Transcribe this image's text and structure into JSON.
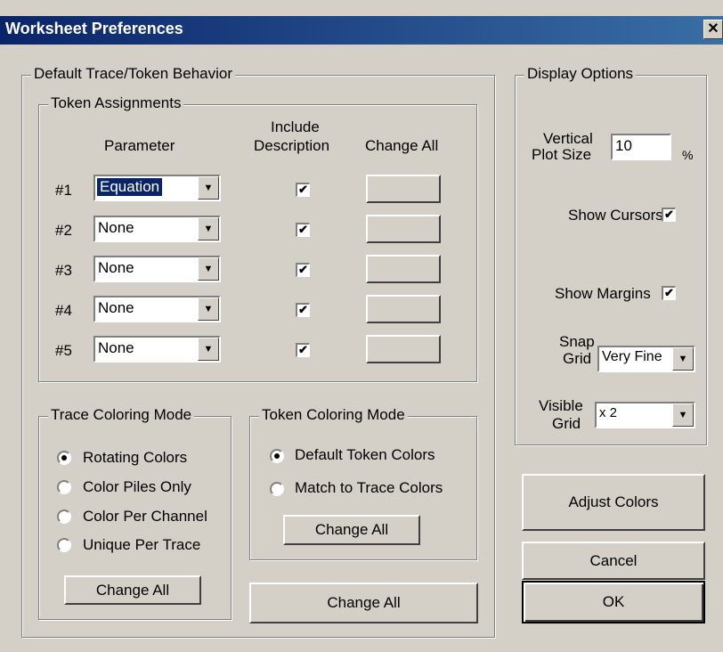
{
  "window": {
    "title": "Worksheet Preferences",
    "close_glyph": "✕"
  },
  "default_trace": {
    "legend": "Default Trace/Token Behavior",
    "token_assignments": {
      "legend": "Token Assignments",
      "headers": {
        "parameter": "Parameter",
        "include_description_1": "Include",
        "include_description_2": "Description",
        "change_all": "Change All"
      },
      "rows": [
        {
          "label": "#1",
          "parameter": "Equation",
          "include": true,
          "selected": true
        },
        {
          "label": "#2",
          "parameter": "None",
          "include": true
        },
        {
          "label": "#3",
          "parameter": "None",
          "include": true
        },
        {
          "label": "#4",
          "parameter": "None",
          "include": true
        },
        {
          "label": "#5",
          "parameter": "None",
          "include": true
        }
      ]
    },
    "trace_coloring": {
      "legend": "Trace Coloring Mode",
      "options": [
        "Rotating Colors",
        "Color Piles Only",
        "Color Per Channel",
        "Unique Per Trace"
      ],
      "selected": "Rotating Colors",
      "button": "Change All"
    },
    "token_coloring": {
      "legend": "Token Coloring Mode",
      "options": [
        "Default Token Colors",
        "Match to Trace Colors"
      ],
      "selected": "Default Token Colors",
      "button": "Change All"
    },
    "change_all_button": "Change All"
  },
  "display_options": {
    "legend": "Display Options",
    "vertical_plot_size_label_1": "Vertical",
    "vertical_plot_size_label_2": "Plot Size",
    "vertical_plot_size_value": "10",
    "vertical_plot_size_unit": "%",
    "show_cursors_label": "Show Cursors",
    "show_cursors": true,
    "show_margins_label": "Show Margins",
    "show_margins": true,
    "snap_grid_label_1": "Snap",
    "snap_grid_label_2": "Grid",
    "snap_grid_value": "Very Fine",
    "visible_grid_label_1": "Visible",
    "visible_grid_label_2": "Grid",
    "visible_grid_value": "x 2"
  },
  "buttons": {
    "adjust_colors": "Adjust Colors",
    "cancel": "Cancel",
    "ok": "OK"
  },
  "glyphs": {
    "check": "✔",
    "dropdown": "▼"
  }
}
